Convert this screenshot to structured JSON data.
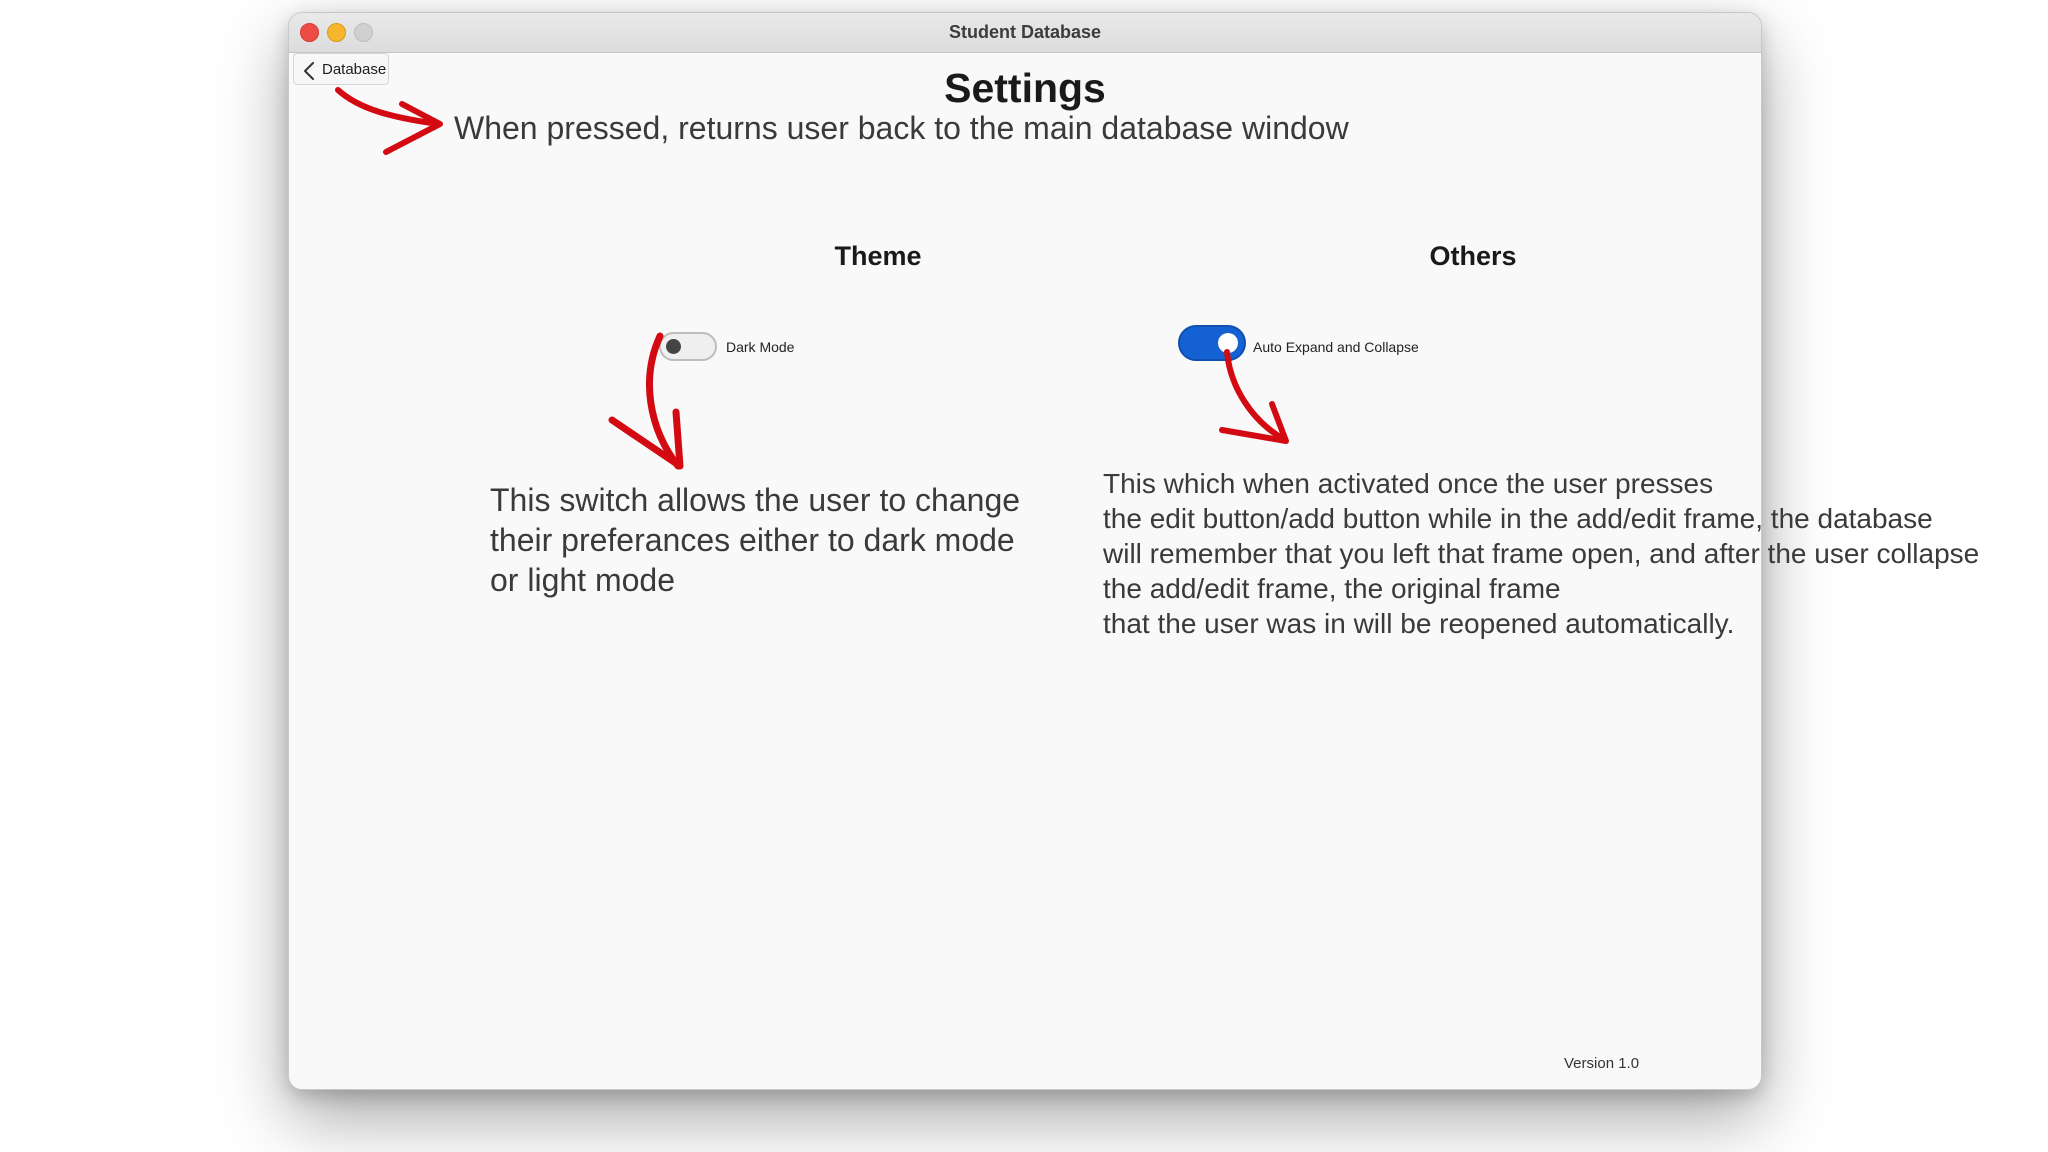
{
  "window": {
    "title": "Student Database"
  },
  "nav": {
    "back_label": "Database"
  },
  "page": {
    "title": "Settings"
  },
  "sections": {
    "theme_heading": "Theme",
    "others_heading": "Others"
  },
  "toggles": {
    "dark_mode": {
      "label": "Dark Mode",
      "state": "off"
    },
    "auto_expand": {
      "label": "Auto Expand and Collapse",
      "state": "on",
      "accent": "#1461d4"
    }
  },
  "footer": {
    "version": "Version 1.0"
  },
  "annotations": {
    "back_note": "When pressed, returns user back to the main database window",
    "theme_note": [
      "This switch allows the user to change",
      "their preferances either to dark mode",
      "or light mode"
    ],
    "others_note": [
      "This which when activated once the user presses",
      "the edit button/add button while in the add/edit frame, the database",
      "will remember that you left that frame open, and after the user collapse",
      "the add/edit frame, the original frame",
      "that the user was in will be reopened automatically."
    ],
    "arrow_color": "#d40a12"
  }
}
